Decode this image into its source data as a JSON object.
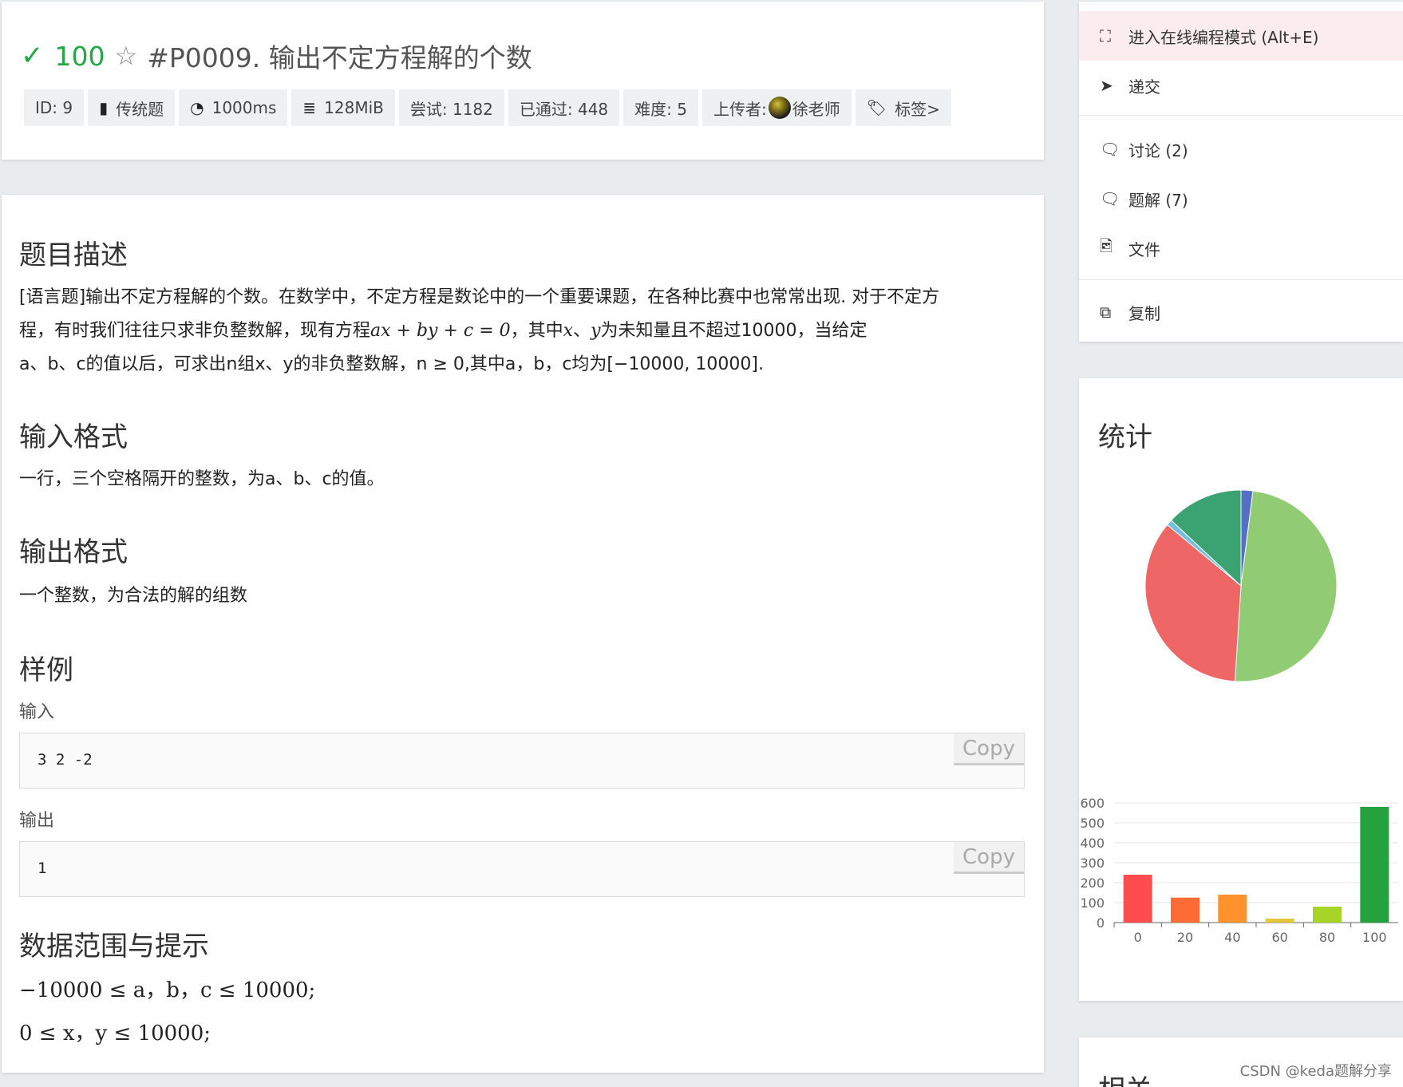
{
  "problem": {
    "score": "100",
    "title": "#P0009. 输出不定方程解的个数",
    "meta": {
      "id": "ID: 9",
      "type": "传统题",
      "time": "1000ms",
      "memory": "128MiB",
      "attempts": "尝试: 1182",
      "passed": "已通过: 448",
      "difficulty": "难度: 5",
      "uploader_prefix": "上传者:",
      "uploader_name": "徐老师",
      "tags": "标签>"
    }
  },
  "content": {
    "desc_heading": "题目描述",
    "desc": {
      "l1": "[语言题]输出不定方程解的个数。在数学中，不定方程是数论中的一个重要课题，在各种比赛中也常常出现. 对于不定方",
      "l2a": "程，有时我们往往只求非负整数解，现有方程",
      "l2m": "ax + by + c = 0",
      "l2b": "，其中",
      "l2x": "x",
      "l2c": "、",
      "l2y": "y",
      "l2d": "为未知量且不超过10000，当给定",
      "l3": "a、b、c的值以后，可求出n组x、y的非负整数解，n ≥ 0,其中a，b，c均为[−10000, 10000]."
    },
    "input_heading": "输入格式",
    "input_text": "一行，三个空格隔开的整数，为a、b、c的值。",
    "output_heading": "输出格式",
    "output_text": "一个整数，为合法的解的组数",
    "sample_heading": "样例",
    "sample_input_label": "输入",
    "sample_input": "3 2 -2",
    "sample_output_label": "输出",
    "sample_output": "1",
    "copy_label": "Copy",
    "range_heading": "数据范围与提示",
    "range_line1": "−10000 ≤ a，b，c ≤ 10000;",
    "range_line2": "0 ≤ x，y ≤ 10000;"
  },
  "sidebar": {
    "menu": [
      {
        "label": "进入在线编程模式 (Alt+E)",
        "icon": "expand-icon"
      },
      {
        "label": "递交",
        "icon": "send-icon"
      },
      {
        "label": "讨论 (2)",
        "icon": "comment-icon"
      },
      {
        "label": "题解 (7)",
        "icon": "comment-icon"
      },
      {
        "label": "文件",
        "icon": "file-image-icon"
      },
      {
        "label": "复制",
        "icon": "copy-icon"
      }
    ],
    "stats_title": "统计",
    "related_title": "相关"
  },
  "chart_data": [
    {
      "type": "pie",
      "values": [
        2,
        49,
        35,
        1,
        13
      ],
      "colors": [
        "#5470c6",
        "#91cc75",
        "#ee6666",
        "#73c0de",
        "#3ba272"
      ]
    },
    {
      "type": "bar",
      "categories": [
        "0",
        "20",
        "40",
        "60",
        "80",
        "100"
      ],
      "values": [
        240,
        125,
        140,
        20,
        80,
        580
      ],
      "colors": [
        "#ff4d4f",
        "#ff6b35",
        "#ff922b",
        "#e5c73a",
        "#a8d428",
        "#25a13d"
      ],
      "y_ticks": [
        "0",
        "100",
        "200",
        "300",
        "400",
        "500",
        "600"
      ],
      "ylim": [
        0,
        600
      ]
    }
  ],
  "watermark": "CSDN @keda题解分享"
}
